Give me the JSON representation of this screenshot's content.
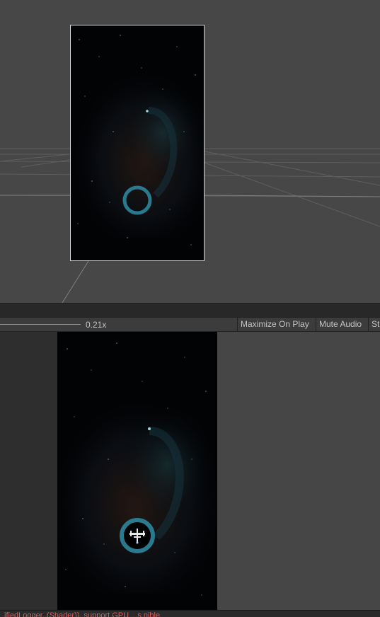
{
  "scene_view": {
    "camera_gizmo_color": "#2a7a8f"
  },
  "game_toolbar": {
    "scale_value_label": "0.21x",
    "scale_value": 0.21,
    "maximize_on_play_label": "Maximize On Play",
    "mute_audio_label": "Mute Audio",
    "stats_label": "St"
  },
  "game_view": {
    "ring_color": "#2a7a8f"
  },
  "status_bar": {
    "message": "ifiedLogger..(Shader)). support GPU ...s nible",
    "color": "#e05a5a"
  }
}
